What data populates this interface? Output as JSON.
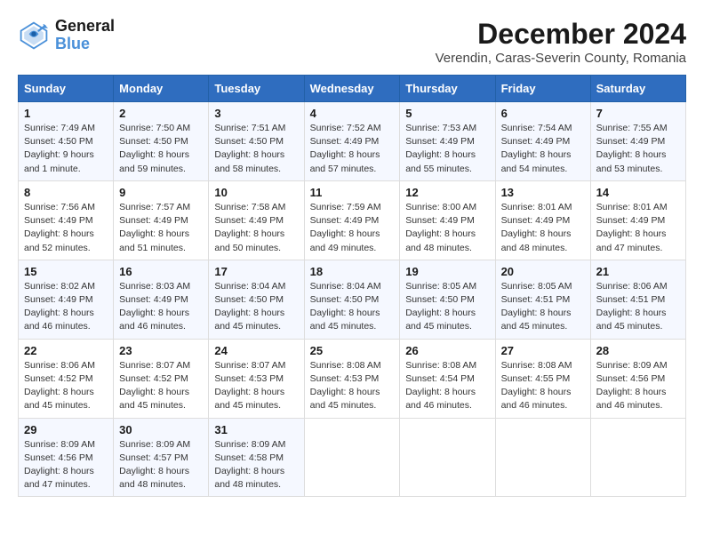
{
  "logo": {
    "line1": "General",
    "line2": "Blue"
  },
  "title": "December 2024",
  "subtitle": "Verendin, Caras-Severin County, Romania",
  "days_of_week": [
    "Sunday",
    "Monday",
    "Tuesday",
    "Wednesday",
    "Thursday",
    "Friday",
    "Saturday"
  ],
  "weeks": [
    [
      {
        "day": "1",
        "sunrise": "7:49 AM",
        "sunset": "4:50 PM",
        "daylight": "9 hours and 1 minute."
      },
      {
        "day": "2",
        "sunrise": "7:50 AM",
        "sunset": "4:50 PM",
        "daylight": "8 hours and 59 minutes."
      },
      {
        "day": "3",
        "sunrise": "7:51 AM",
        "sunset": "4:50 PM",
        "daylight": "8 hours and 58 minutes."
      },
      {
        "day": "4",
        "sunrise": "7:52 AM",
        "sunset": "4:49 PM",
        "daylight": "8 hours and 57 minutes."
      },
      {
        "day": "5",
        "sunrise": "7:53 AM",
        "sunset": "4:49 PM",
        "daylight": "8 hours and 55 minutes."
      },
      {
        "day": "6",
        "sunrise": "7:54 AM",
        "sunset": "4:49 PM",
        "daylight": "8 hours and 54 minutes."
      },
      {
        "day": "7",
        "sunrise": "7:55 AM",
        "sunset": "4:49 PM",
        "daylight": "8 hours and 53 minutes."
      }
    ],
    [
      {
        "day": "8",
        "sunrise": "7:56 AM",
        "sunset": "4:49 PM",
        "daylight": "8 hours and 52 minutes."
      },
      {
        "day": "9",
        "sunrise": "7:57 AM",
        "sunset": "4:49 PM",
        "daylight": "8 hours and 51 minutes."
      },
      {
        "day": "10",
        "sunrise": "7:58 AM",
        "sunset": "4:49 PM",
        "daylight": "8 hours and 50 minutes."
      },
      {
        "day": "11",
        "sunrise": "7:59 AM",
        "sunset": "4:49 PM",
        "daylight": "8 hours and 49 minutes."
      },
      {
        "day": "12",
        "sunrise": "8:00 AM",
        "sunset": "4:49 PM",
        "daylight": "8 hours and 48 minutes."
      },
      {
        "day": "13",
        "sunrise": "8:01 AM",
        "sunset": "4:49 PM",
        "daylight": "8 hours and 48 minutes."
      },
      {
        "day": "14",
        "sunrise": "8:01 AM",
        "sunset": "4:49 PM",
        "daylight": "8 hours and 47 minutes."
      }
    ],
    [
      {
        "day": "15",
        "sunrise": "8:02 AM",
        "sunset": "4:49 PM",
        "daylight": "8 hours and 46 minutes."
      },
      {
        "day": "16",
        "sunrise": "8:03 AM",
        "sunset": "4:49 PM",
        "daylight": "8 hours and 46 minutes."
      },
      {
        "day": "17",
        "sunrise": "8:04 AM",
        "sunset": "4:50 PM",
        "daylight": "8 hours and 45 minutes."
      },
      {
        "day": "18",
        "sunrise": "8:04 AM",
        "sunset": "4:50 PM",
        "daylight": "8 hours and 45 minutes."
      },
      {
        "day": "19",
        "sunrise": "8:05 AM",
        "sunset": "4:50 PM",
        "daylight": "8 hours and 45 minutes."
      },
      {
        "day": "20",
        "sunrise": "8:05 AM",
        "sunset": "4:51 PM",
        "daylight": "8 hours and 45 minutes."
      },
      {
        "day": "21",
        "sunrise": "8:06 AM",
        "sunset": "4:51 PM",
        "daylight": "8 hours and 45 minutes."
      }
    ],
    [
      {
        "day": "22",
        "sunrise": "8:06 AM",
        "sunset": "4:52 PM",
        "daylight": "8 hours and 45 minutes."
      },
      {
        "day": "23",
        "sunrise": "8:07 AM",
        "sunset": "4:52 PM",
        "daylight": "8 hours and 45 minutes."
      },
      {
        "day": "24",
        "sunrise": "8:07 AM",
        "sunset": "4:53 PM",
        "daylight": "8 hours and 45 minutes."
      },
      {
        "day": "25",
        "sunrise": "8:08 AM",
        "sunset": "4:53 PM",
        "daylight": "8 hours and 45 minutes."
      },
      {
        "day": "26",
        "sunrise": "8:08 AM",
        "sunset": "4:54 PM",
        "daylight": "8 hours and 46 minutes."
      },
      {
        "day": "27",
        "sunrise": "8:08 AM",
        "sunset": "4:55 PM",
        "daylight": "8 hours and 46 minutes."
      },
      {
        "day": "28",
        "sunrise": "8:09 AM",
        "sunset": "4:56 PM",
        "daylight": "8 hours and 46 minutes."
      }
    ],
    [
      {
        "day": "29",
        "sunrise": "8:09 AM",
        "sunset": "4:56 PM",
        "daylight": "8 hours and 47 minutes."
      },
      {
        "day": "30",
        "sunrise": "8:09 AM",
        "sunset": "4:57 PM",
        "daylight": "8 hours and 48 minutes."
      },
      {
        "day": "31",
        "sunrise": "8:09 AM",
        "sunset": "4:58 PM",
        "daylight": "8 hours and 48 minutes."
      },
      null,
      null,
      null,
      null
    ]
  ]
}
